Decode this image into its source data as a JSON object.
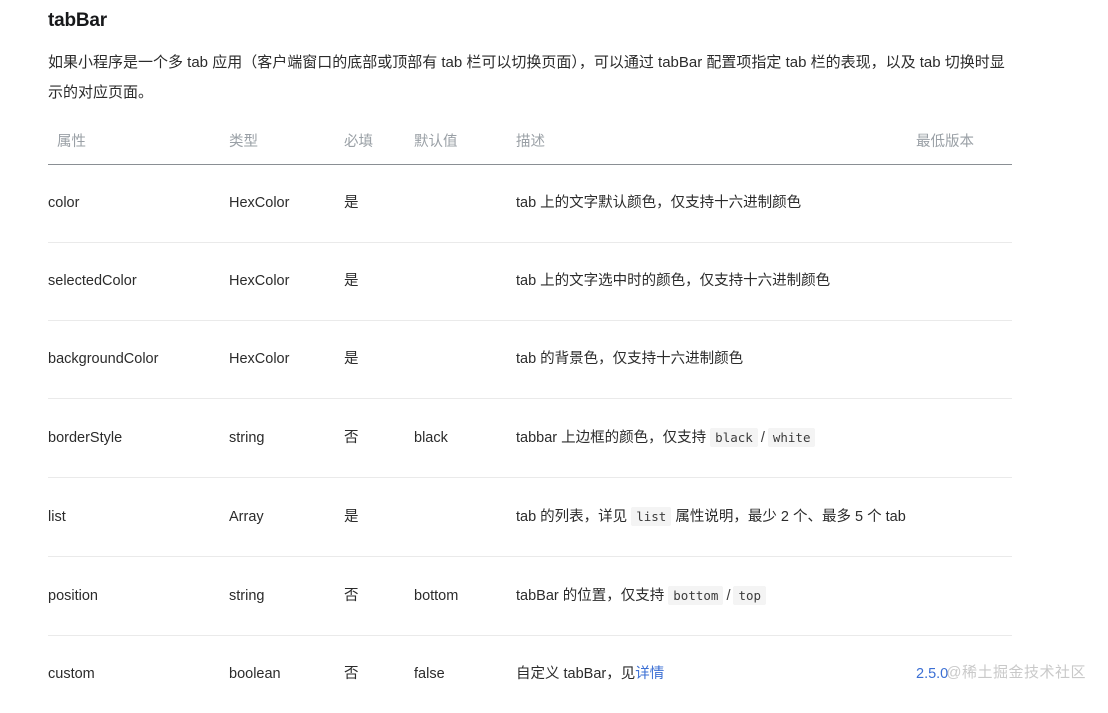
{
  "doc": {
    "title": "tabBar",
    "intro": "如果小程序是一个多 tab 应用（客户端窗口的底部或顶部有 tab 栏可以切换页面），可以通过 tabBar 配置项指定 tab 栏的表现，以及 tab 切换时显示的对应页面。"
  },
  "table": {
    "headers": {
      "attribute": "属性",
      "type": "类型",
      "required": "必填",
      "default": "默认值",
      "description": "描述",
      "version": "最低版本"
    },
    "rows": [
      {
        "attribute": "color",
        "type": "HexColor",
        "required": "是",
        "default": "",
        "description": "tab 上的文字默认颜色，仅支持十六进制颜色",
        "version": ""
      },
      {
        "attribute": "selectedColor",
        "type": "HexColor",
        "required": "是",
        "default": "",
        "description": "tab 上的文字选中时的颜色，仅支持十六进制颜色",
        "version": ""
      },
      {
        "attribute": "backgroundColor",
        "type": "HexColor",
        "required": "是",
        "default": "",
        "description": "tab 的背景色，仅支持十六进制颜色",
        "version": ""
      },
      {
        "attribute": "borderStyle",
        "type": "string",
        "required": "否",
        "default": "black",
        "description_prefix": "tabbar 上边框的颜色，仅支持 ",
        "description_code_1": "black",
        "description_sep": "/",
        "description_code_2": "white",
        "description_suffix": "",
        "version": ""
      },
      {
        "attribute": "list",
        "type": "Array",
        "required": "是",
        "default": "",
        "description_prefix": "tab 的列表，详见 ",
        "description_code_1": "list",
        "description_suffix": " 属性说明，最少 2 个、最多 5 个 tab",
        "version": ""
      },
      {
        "attribute": "position",
        "type": "string",
        "required": "否",
        "default": "bottom",
        "description_prefix": "tabBar 的位置，仅支持 ",
        "description_code_1": "bottom",
        "description_sep": "/",
        "description_code_2": "top",
        "description_suffix": "",
        "version": ""
      },
      {
        "attribute": "custom",
        "type": "boolean",
        "required": "否",
        "default": "false",
        "description_prefix": "自定义 tabBar，见",
        "description_link": "详情",
        "description_suffix": "",
        "version": "2.5.0"
      }
    ]
  },
  "watermark": {
    "text": "@稀土掘金技术社区"
  },
  "colors": {
    "link": "#3b6fd4",
    "header_text": "#9aa0a6",
    "body_text": "#2b2b2b",
    "row_divider": "#eaeaea",
    "header_divider": "#8a8f94",
    "code_bg": "#f4f4f4",
    "watermark": "#c9c9c9"
  }
}
